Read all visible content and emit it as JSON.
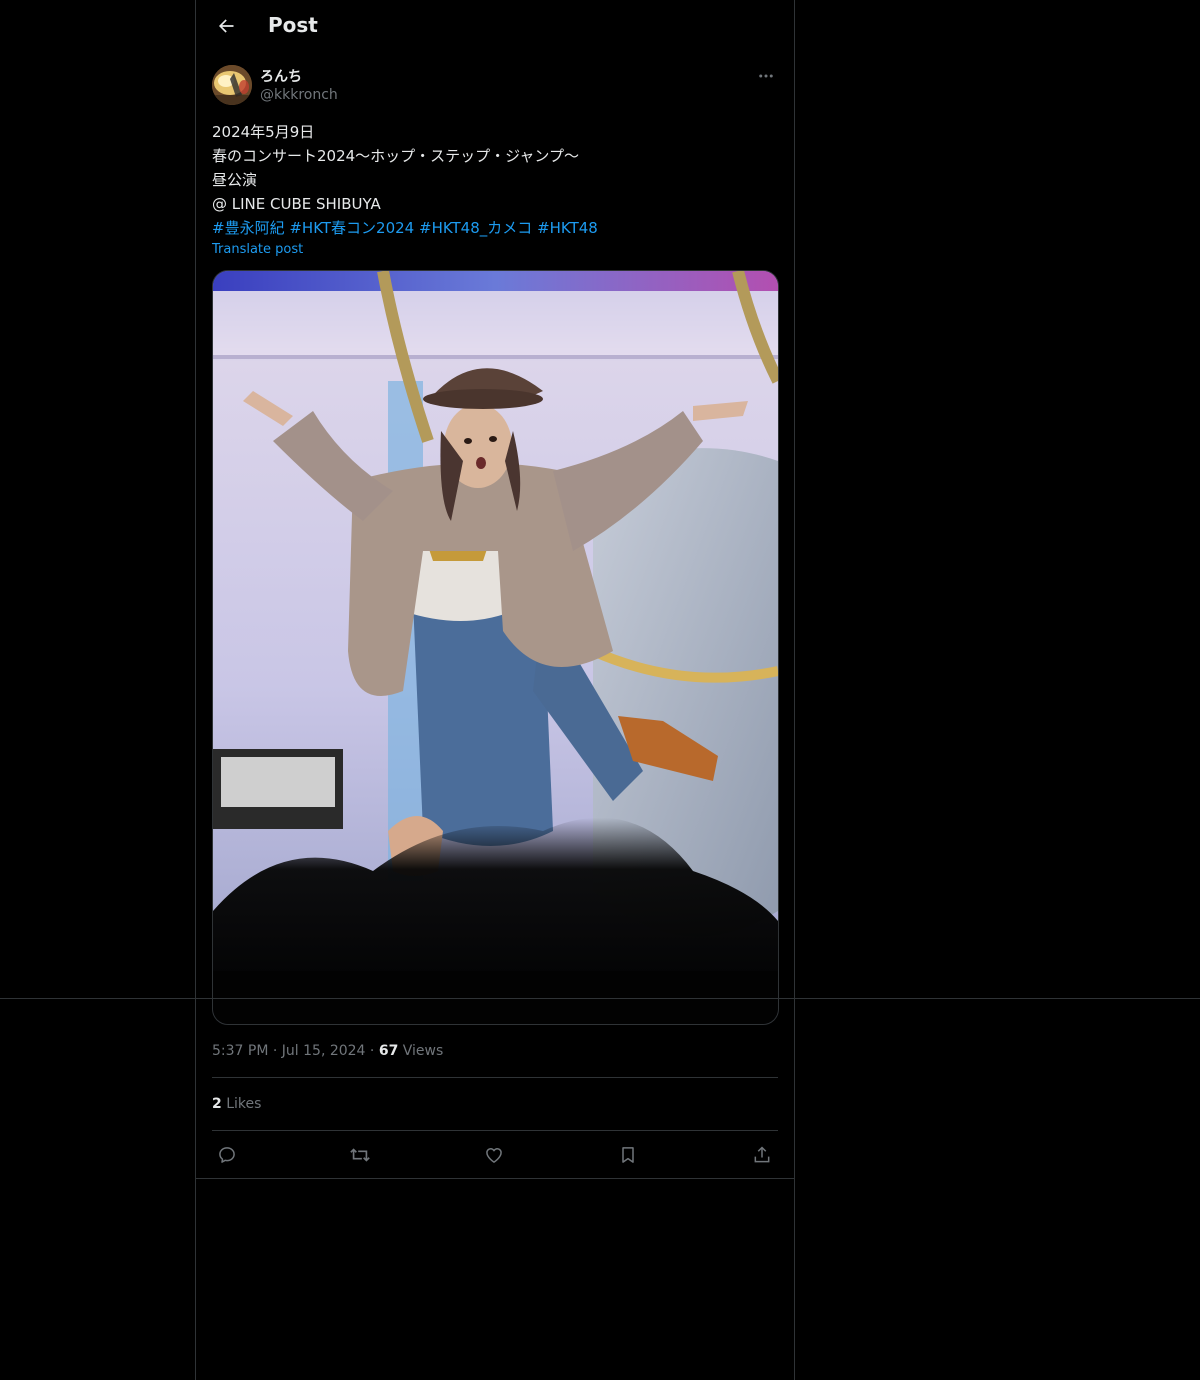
{
  "header": {
    "title": "Post",
    "back_icon": "arrow-left-icon"
  },
  "author": {
    "display_name": "ろんち",
    "handle": "@kkkronch",
    "more_icon": "more-horizontal-icon"
  },
  "post": {
    "lines": [
      "2024年5月9日",
      "春のコンサート2024〜ホップ・ステップ・ジャンプ〜",
      "昼公演",
      "@ LINE CUBE SHIBUYA"
    ],
    "hashtags": [
      "#豊永阿紀",
      "#HKT春コン2024",
      "#HKT48_カメコ",
      "#HKT48"
    ],
    "translate_label": "Translate post"
  },
  "meta": {
    "time": "5:37 PM",
    "separator": "·",
    "date": "Jul 15, 2024",
    "views_count": "67",
    "views_label": "Views"
  },
  "likes": {
    "count": "2",
    "label": "Likes"
  },
  "actions": [
    "reply-icon",
    "repost-icon",
    "like-icon",
    "bookmark-icon",
    "share-icon"
  ],
  "colors": {
    "background": "#000000",
    "text": "#e7e9ea",
    "secondary": "#71767b",
    "accent": "#1d9bf0",
    "border": "#2f3336"
  }
}
